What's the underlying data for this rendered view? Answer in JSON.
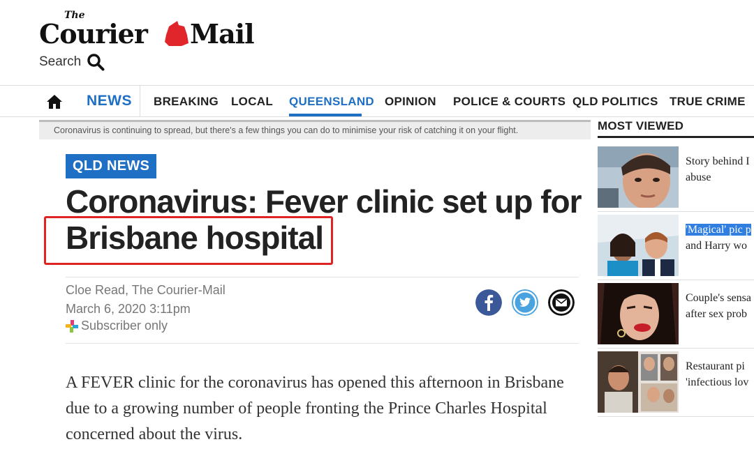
{
  "masthead": {
    "the": "The",
    "logo_text": "Courier Mail"
  },
  "search": {
    "label": "Search"
  },
  "nav": {
    "news": "NEWS",
    "items": [
      "BREAKING",
      "LOCAL",
      "QUEENSLAND",
      "OPINION",
      "POLICE & COURTS",
      "QLD POLITICS",
      "TRUE CRIME"
    ],
    "active": "QUEENSLAND"
  },
  "caption": "Coronavirus is continuing to spread, but there's a few things you can do to minimise your risk of catching it on your flight.",
  "article": {
    "tag": "QLD NEWS",
    "headline_line1": "Coronavirus: Fever clinic set up for",
    "headline_line2": "Brisbane hospital",
    "author": "Cloe Read, The Courier-Mail",
    "date": "March 6, 2020 3:11pm",
    "subscriber": "Subscriber only",
    "body": "A FEVER clinic for the coronavirus has opened this afternoon in Brisbane due to a growing number of people fronting the Prince Charles Hospital concerned about the virus."
  },
  "share": {
    "icons": [
      "facebook-icon",
      "twitter-icon",
      "email-icon"
    ]
  },
  "most_viewed": {
    "header": "MOST VIEWED",
    "items": [
      {
        "line1": "Story behind I",
        "line2": "abuse"
      },
      {
        "line1": "'Magical' pic p",
        "line2": "and Harry wo"
      },
      {
        "line1": "Couple's sensa",
        "line2": "after sex prob"
      },
      {
        "line1": "Restaurant pi",
        "line2": "'infectious lov"
      }
    ]
  },
  "colors": {
    "brand_blue": "#1f6fc4",
    "highlight_red": "#e02424",
    "logo_red": "#e0262b"
  }
}
